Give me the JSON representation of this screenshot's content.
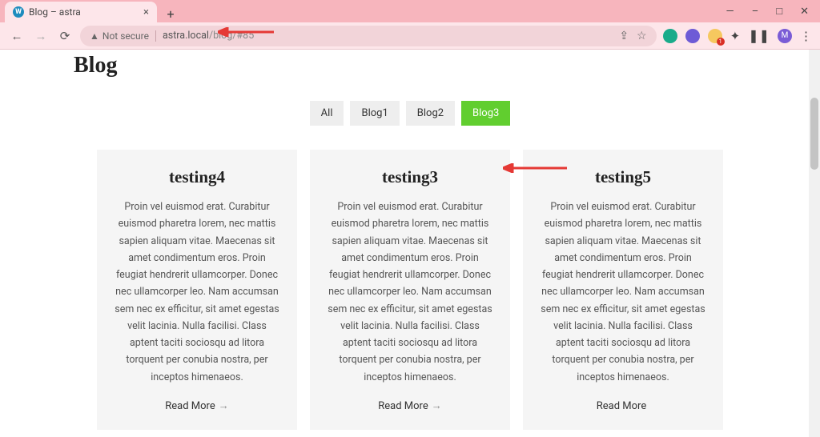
{
  "browser": {
    "tab_title": "Blog – astra",
    "security_label": "Not secure",
    "url_host": "astra.local",
    "url_path": "/blog/#85"
  },
  "page_title": "Blog",
  "filters": {
    "all": "All",
    "b1": "Blog1",
    "b2": "Blog2",
    "b3": "Blog3",
    "active": "b3"
  },
  "posts": [
    {
      "title": "testing4",
      "excerpt": "Proin vel euismod erat. Curabitur euismod pharetra lorem, nec mattis sapien aliquam vitae. Maecenas sit amet condimentum eros. Proin feugiat hendrerit ullamcorper. Donec nec ullamcorper leo. Nam accumsan sem nec ex efficitur, sit amet egestas velit lacinia. Nulla facilisi. Class aptent taciti sociosqu ad litora torquent per conubia nostra, per inceptos himenaeos.",
      "more": "Read More"
    },
    {
      "title": "testing3",
      "excerpt": "Proin vel euismod erat. Curabitur euismod pharetra lorem, nec mattis sapien aliquam vitae. Maecenas sit amet condimentum eros. Proin feugiat hendrerit ullamcorper. Donec nec ullamcorper leo. Nam accumsan sem nec ex efficitur, sit amet egestas velit lacinia. Nulla facilisi. Class aptent taciti sociosqu ad litora torquent per conubia nostra, per inceptos himenaeos.",
      "more": "Read More"
    },
    {
      "title": "testing5",
      "excerpt": "Proin vel euismod erat. Curabitur euismod pharetra lorem, nec mattis sapien aliquam vitae. Maecenas sit amet condimentum eros. Proin feugiat hendrerit ullamcorper. Donec nec ullamcorper leo. Nam accumsan sem nec ex efficitur, sit amet egestas velit lacinia. Nulla facilisi. Class aptent taciti sociosqu ad litora torquent per conubia nostra, per inceptos himenaeos.",
      "more": "Read More"
    }
  ]
}
